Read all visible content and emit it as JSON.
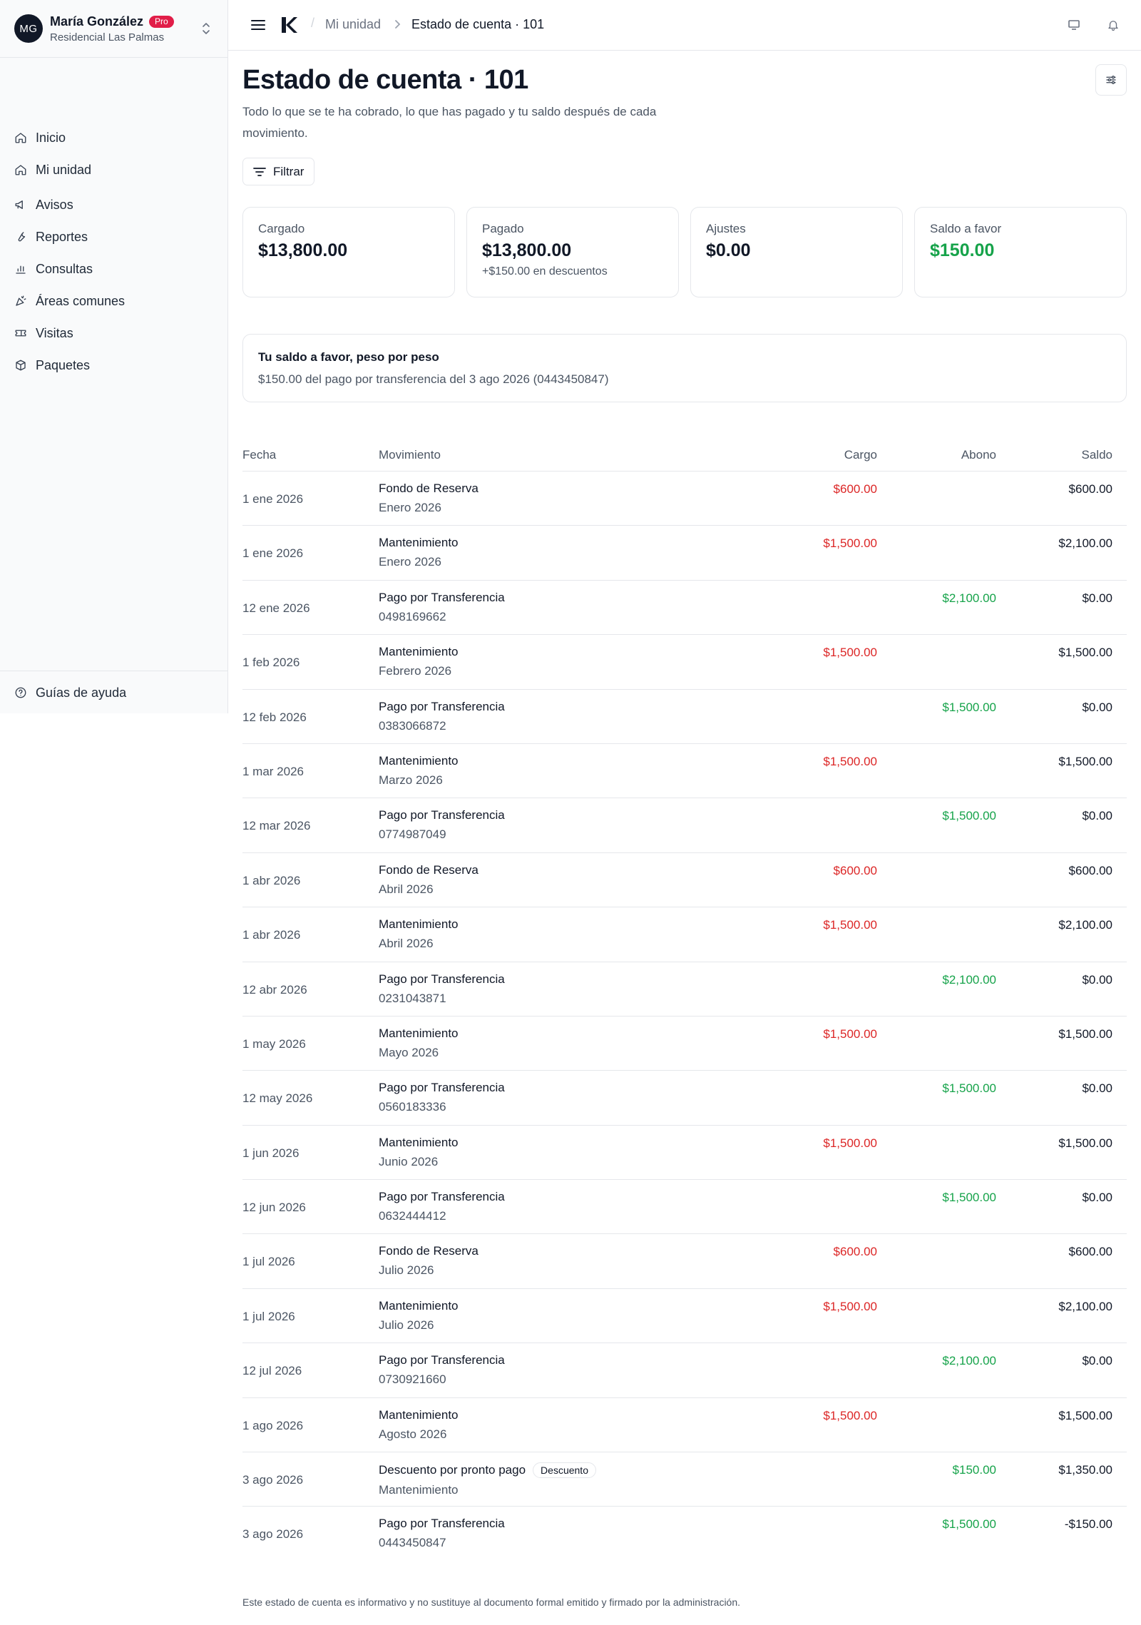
{
  "user": {
    "initials": "MG",
    "name": "María González",
    "plan_badge": "Pro",
    "residence": "Residencial Las Palmas"
  },
  "nav": {
    "items": [
      {
        "label": "Inicio",
        "icon": "home-icon"
      },
      {
        "label": "Mi unidad",
        "icon": "home-icon"
      },
      {
        "label": "Avisos",
        "icon": "megaphone-icon"
      },
      {
        "label": "Reportes",
        "icon": "wrench-icon"
      },
      {
        "label": "Consultas",
        "icon": "bar-chart-icon"
      },
      {
        "label": "Áreas comunes",
        "icon": "party-icon"
      },
      {
        "label": "Visitas",
        "icon": "ticket-icon"
      },
      {
        "label": "Paquetes",
        "icon": "package-icon"
      }
    ],
    "help": {
      "label": "Guías de ayuda",
      "icon": "help-circle-icon"
    }
  },
  "header": {
    "breadcrumb_parent": "Mi unidad",
    "breadcrumb_current": "Estado de cuenta · 101"
  },
  "page": {
    "title": "Estado de cuenta · 101",
    "description": "Todo lo que se te ha cobrado, lo que has pagado y tu saldo después de cada movimiento.",
    "filter_label": "Filtrar"
  },
  "summary": [
    {
      "label": "Cargado",
      "value": "$13,800.00",
      "note": ""
    },
    {
      "label": "Pagado",
      "value": "$13,800.00",
      "note": "+$150.00 en descuentos"
    },
    {
      "label": "Ajustes",
      "value": "$0.00",
      "note": ""
    },
    {
      "label": "Saldo a favor",
      "value": "$150.00",
      "note": ""
    }
  ],
  "credit_info": {
    "title": "Tu saldo a favor, peso por peso",
    "text": "$150.00 del pago por transferencia del 3 ago 2026 (0443450847)"
  },
  "table": {
    "headers": {
      "date": "Fecha",
      "movement": "Movimiento",
      "charge": "Cargo",
      "credit": "Abono",
      "balance": "Saldo"
    },
    "rows": [
      {
        "date": "1 ene 2026",
        "title": "Fondo de Reserva",
        "sub": "Enero 2026",
        "badge": "",
        "charge": "$600.00",
        "credit": "",
        "balance": "$600.00"
      },
      {
        "date": "1 ene 2026",
        "title": "Mantenimiento",
        "sub": "Enero 2026",
        "badge": "",
        "charge": "$1,500.00",
        "credit": "",
        "balance": "$2,100.00"
      },
      {
        "date": "12 ene 2026",
        "title": "Pago por Transferencia",
        "sub": "0498169662",
        "badge": "",
        "charge": "",
        "credit": "$2,100.00",
        "balance": "$0.00"
      },
      {
        "date": "1 feb 2026",
        "title": "Mantenimiento",
        "sub": "Febrero 2026",
        "badge": "",
        "charge": "$1,500.00",
        "credit": "",
        "balance": "$1,500.00"
      },
      {
        "date": "12 feb 2026",
        "title": "Pago por Transferencia",
        "sub": "0383066872",
        "badge": "",
        "charge": "",
        "credit": "$1,500.00",
        "balance": "$0.00"
      },
      {
        "date": "1 mar 2026",
        "title": "Mantenimiento",
        "sub": "Marzo 2026",
        "badge": "",
        "charge": "$1,500.00",
        "credit": "",
        "balance": "$1,500.00"
      },
      {
        "date": "12 mar 2026",
        "title": "Pago por Transferencia",
        "sub": "0774987049",
        "badge": "",
        "charge": "",
        "credit": "$1,500.00",
        "balance": "$0.00"
      },
      {
        "date": "1 abr 2026",
        "title": "Fondo de Reserva",
        "sub": "Abril 2026",
        "badge": "",
        "charge": "$600.00",
        "credit": "",
        "balance": "$600.00"
      },
      {
        "date": "1 abr 2026",
        "title": "Mantenimiento",
        "sub": "Abril 2026",
        "badge": "",
        "charge": "$1,500.00",
        "credit": "",
        "balance": "$2,100.00"
      },
      {
        "date": "12 abr 2026",
        "title": "Pago por Transferencia",
        "sub": "0231043871",
        "badge": "",
        "charge": "",
        "credit": "$2,100.00",
        "balance": "$0.00"
      },
      {
        "date": "1 may 2026",
        "title": "Mantenimiento",
        "sub": "Mayo 2026",
        "badge": "",
        "charge": "$1,500.00",
        "credit": "",
        "balance": "$1,500.00"
      },
      {
        "date": "12 may 2026",
        "title": "Pago por Transferencia",
        "sub": "0560183336",
        "badge": "",
        "charge": "",
        "credit": "$1,500.00",
        "balance": "$0.00"
      },
      {
        "date": "1 jun 2026",
        "title": "Mantenimiento",
        "sub": "Junio 2026",
        "badge": "",
        "charge": "$1,500.00",
        "credit": "",
        "balance": "$1,500.00"
      },
      {
        "date": "12 jun 2026",
        "title": "Pago por Transferencia",
        "sub": "0632444412",
        "badge": "",
        "charge": "",
        "credit": "$1,500.00",
        "balance": "$0.00"
      },
      {
        "date": "1 jul 2026",
        "title": "Fondo de Reserva",
        "sub": "Julio 2026",
        "badge": "",
        "charge": "$600.00",
        "credit": "",
        "balance": "$600.00"
      },
      {
        "date": "1 jul 2026",
        "title": "Mantenimiento",
        "sub": "Julio 2026",
        "badge": "",
        "charge": "$1,500.00",
        "credit": "",
        "balance": "$2,100.00"
      },
      {
        "date": "12 jul 2026",
        "title": "Pago por Transferencia",
        "sub": "0730921660",
        "badge": "",
        "charge": "",
        "credit": "$2,100.00",
        "balance": "$0.00"
      },
      {
        "date": "1 ago 2026",
        "title": "Mantenimiento",
        "sub": "Agosto 2026",
        "badge": "",
        "charge": "$1,500.00",
        "credit": "",
        "balance": "$1,500.00"
      },
      {
        "date": "3 ago 2026",
        "title": "Descuento por pronto pago",
        "sub": "Mantenimiento",
        "badge": "Descuento",
        "charge": "",
        "credit": "$150.00",
        "balance": "$1,350.00"
      },
      {
        "date": "3 ago 2026",
        "title": "Pago por Transferencia",
        "sub": "0443450847",
        "badge": "",
        "charge": "",
        "credit": "$1,500.00",
        "balance": "-$150.00"
      }
    ]
  },
  "footer": {
    "note": "Este estado de cuenta es informativo y no sustituye al documento formal emitido y firmado por la administración."
  },
  "colors": {
    "charge": "#dc2626",
    "credit": "#16a34a",
    "pro_badge": "#e11d48"
  }
}
